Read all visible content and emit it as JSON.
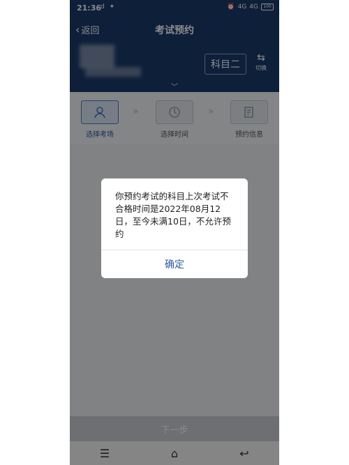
{
  "status_bar": {
    "time": "21:36",
    "left_icons": "d ✦",
    "signal_1": "4G",
    "signal_2": "4G",
    "battery": "100"
  },
  "header": {
    "back_label": "返回",
    "title": "考试预约",
    "subject": "科目二",
    "switch_label": "切换"
  },
  "steps": [
    {
      "label": "选择考场",
      "icon": "user-location-icon",
      "active": true
    },
    {
      "label": "选择时间",
      "icon": "clock-icon",
      "active": false
    },
    {
      "label": "预约信息",
      "icon": "document-icon",
      "active": false
    }
  ],
  "dialog": {
    "message": "你预约考试的科目上次考试不合格时间是2022年08月12日，至今未满10日，不允许预约",
    "confirm_label": "确定"
  },
  "footer": {
    "next_label": "下一步"
  },
  "nav": [
    "menu-icon",
    "home-icon",
    "back-icon"
  ],
  "colors": {
    "header": "#1a3a6b",
    "accent": "#2f5aa3"
  }
}
